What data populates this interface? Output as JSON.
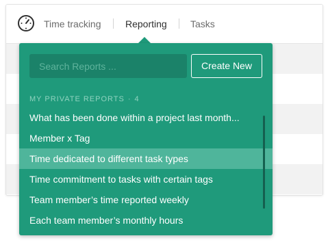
{
  "nav": {
    "items": [
      {
        "label": "Time tracking"
      },
      {
        "label": "Reporting"
      },
      {
        "label": "Tasks"
      }
    ]
  },
  "dropdown": {
    "search_placeholder": "Search Reports ...",
    "create_label": "Create New",
    "section_title": "MY PRIVATE REPORTS",
    "section_separator": "·",
    "section_count": "4",
    "reports": [
      {
        "label": "What has been done within a project last month..."
      },
      {
        "label": "Member x Tag"
      },
      {
        "label": "Time dedicated to different task types"
      },
      {
        "label": "Time commitment to tasks with certain tags"
      },
      {
        "label": "Team member’s time reported weekly"
      },
      {
        "label": "Each team member’s monthly hours"
      }
    ]
  },
  "colors": {
    "accent": "#1f9a7b",
    "highlight": "#4fb59b",
    "search_bg": "#1b8269"
  },
  "icons": {
    "logo": "stopwatch-icon"
  }
}
